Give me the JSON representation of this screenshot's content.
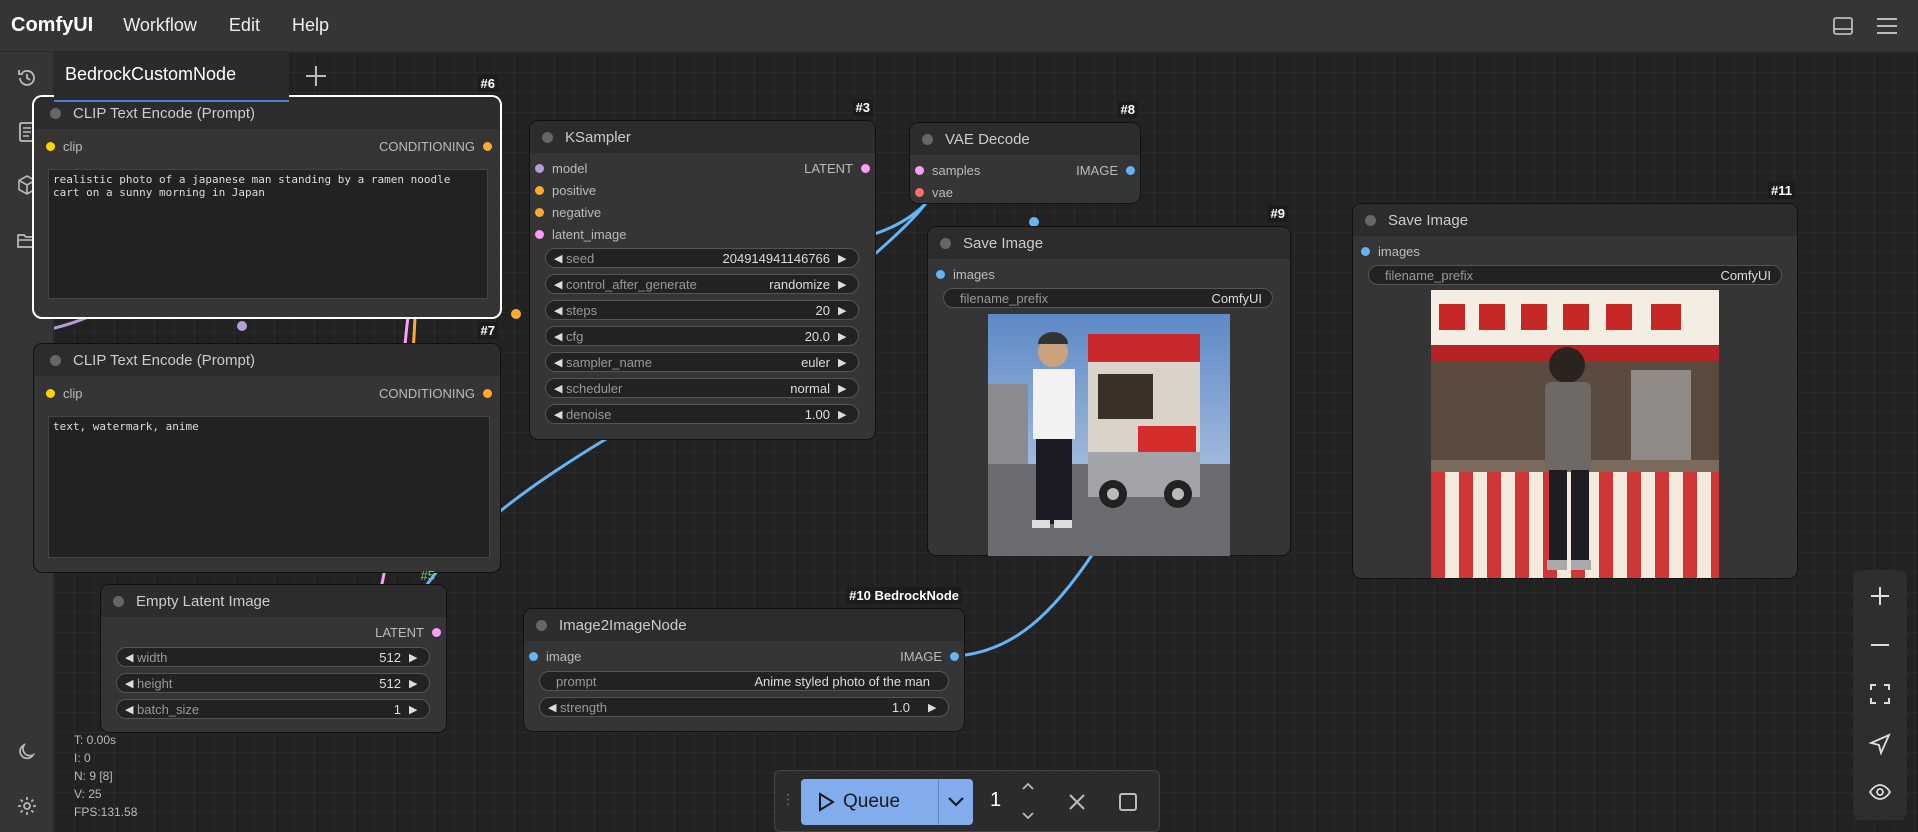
{
  "menubar": {
    "brand": "ComfyUI",
    "items": [
      "Workflow",
      "Edit",
      "Help"
    ]
  },
  "workflow_tab": {
    "name": "BedrockCustomNode"
  },
  "nodes": {
    "clip_pos": {
      "id": "#6",
      "title": "CLIP Text Encode (Prompt)",
      "input": "clip",
      "output": "CONDITIONING",
      "text": "realistic photo of a japanese man standing by a ramen noodle cart on a sunny morning in Japan"
    },
    "clip_neg": {
      "id": "#7",
      "title": "CLIP Text Encode (Prompt)",
      "input": "clip",
      "output": "CONDITIONING",
      "text": "text, watermark, anime"
    },
    "ksampler": {
      "id": "#3",
      "title": "KSampler",
      "inputs": [
        "model",
        "positive",
        "negative",
        "latent_image"
      ],
      "output": "LATENT",
      "widgets": [
        {
          "name": "seed",
          "value": "204914941146766"
        },
        {
          "name": "control_after_generate",
          "value": "randomize"
        },
        {
          "name": "steps",
          "value": "20"
        },
        {
          "name": "cfg",
          "value": "20.0"
        },
        {
          "name": "sampler_name",
          "value": "euler"
        },
        {
          "name": "scheduler",
          "value": "normal"
        },
        {
          "name": "denoise",
          "value": "1.00"
        }
      ]
    },
    "vae_decode": {
      "id": "#8",
      "title": "VAE Decode",
      "inputs": [
        "samples",
        "vae"
      ],
      "output": "IMAGE"
    },
    "save9": {
      "id": "#9",
      "title": "Save Image",
      "input": "images",
      "widget": {
        "name": "filename_prefix",
        "value": "ComfyUI"
      }
    },
    "save11": {
      "id": "#11",
      "title": "Save Image",
      "input": "images",
      "widget": {
        "name": "filename_prefix",
        "value": "ComfyUI"
      }
    },
    "latent": {
      "id": "#5",
      "title": "Empty Latent Image",
      "output": "LATENT",
      "widgets": [
        {
          "name": "width",
          "value": "512"
        },
        {
          "name": "height",
          "value": "512"
        },
        {
          "name": "batch_size",
          "value": "1"
        }
      ]
    },
    "img2img": {
      "id": "#10 BedrockNode",
      "title": "Image2ImageNode",
      "input": "image",
      "output": "IMAGE",
      "prompt": {
        "name": "prompt",
        "value": "Anime styled photo of the man"
      },
      "strength": {
        "name": "strength",
        "value": "1.0"
      }
    }
  },
  "stats": [
    "T: 0.00s",
    "I: 0",
    "N: 9 [8]",
    "V: 25",
    "FPS:131.58"
  ],
  "queue": {
    "label": "Queue",
    "count": "1"
  },
  "colors": {
    "model": "#b39ddb",
    "clip": "#ffd500",
    "conditioning": "#ffa931",
    "latent": "#ff9cf9",
    "vae": "#ff6e6e",
    "image": "#64b5f6",
    "accent": "#82acec"
  }
}
